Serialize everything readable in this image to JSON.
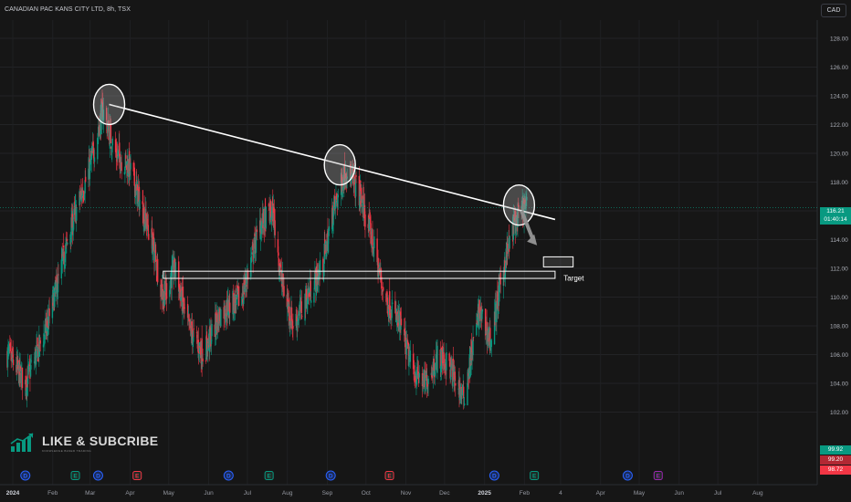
{
  "header": {
    "symbol_title": "CANADIAN PAC KANS CITY LTD, 8h, TSX",
    "currency_button": "CAD"
  },
  "price_scale": {
    "current_price": "116.21",
    "countdown": "01:40:14",
    "current_color": "#089981",
    "tags": [
      {
        "label": "99.92",
        "color": "#089981"
      },
      {
        "label": "99.20",
        "color": "#b22833"
      },
      {
        "label": "98.72",
        "color": "#f23645"
      }
    ]
  },
  "watermark": {
    "title": "LIKE & SUBCRIBE",
    "subtitle": "KNOWLEDGE BASED TRADING"
  },
  "annotations": {
    "target_label": "Target"
  },
  "colors": {
    "up": "#089981",
    "down": "#f23645",
    "background": "#161616",
    "trendline": "#ffffff"
  },
  "chart_data": {
    "type": "candlestick",
    "title": "CANADIAN PAC KANS CITY LTD, 8h, TSX",
    "xlabel": "",
    "ylabel": "",
    "y_axis_side": "right",
    "ylim": [
      97,
      129
    ],
    "y_ticks": [
      "128.00",
      "126.00",
      "124.00",
      "122.00",
      "120.00",
      "118.00",
      "116.00",
      "114.00",
      "112.00",
      "110.00",
      "108.00",
      "106.00",
      "104.00",
      "102.00"
    ],
    "x_ticks": [
      "2024",
      "Feb",
      "Mar",
      "Apr",
      "May",
      "Jun",
      "Jul",
      "Aug",
      "Sep",
      "Oct",
      "Nov",
      "Dec",
      "2025",
      "Feb",
      "4",
      "Apr",
      "May",
      "Jun",
      "Jul",
      "Aug"
    ],
    "grid": true,
    "series": [
      {
        "type": "close_path",
        "x": [
          "2024-01-02",
          "2024-01-15",
          "2024-02-01",
          "2024-02-20",
          "2024-03-05",
          "2024-03-15",
          "2024-03-25",
          "2024-04-05",
          "2024-04-22",
          "2024-05-01",
          "2024-05-10",
          "2024-05-20",
          "2024-06-01",
          "2024-06-15",
          "2024-07-01",
          "2024-07-15",
          "2024-07-25",
          "2024-08-01",
          "2024-08-10",
          "2024-08-20",
          "2024-09-01",
          "2024-09-10",
          "2024-09-20",
          "2024-10-01",
          "2024-10-10",
          "2024-10-20",
          "2024-11-01",
          "2024-11-10",
          "2024-11-20",
          "2024-12-01",
          "2024-12-10",
          "2024-12-20",
          "2025-01-01",
          "2025-01-10",
          "2025-01-20",
          "2025-01-28",
          "2025-02-05"
        ],
        "values": [
          106.0,
          104.0,
          108.0,
          115.0,
          119.0,
          123.0,
          120.0,
          119.0,
          114.0,
          110.0,
          112.0,
          108.0,
          106.0,
          109.0,
          110.0,
          115.0,
          116.0,
          111.0,
          108.0,
          110.0,
          112.0,
          116.0,
          119.0,
          117.0,
          114.0,
          110.0,
          108.0,
          105.0,
          104.0,
          106.0,
          105.0,
          103.0,
          109.0,
          107.0,
          112.0,
          115.0,
          116.2
        ]
      }
    ],
    "price_lines": [
      {
        "value": 116.21,
        "color": "#089981",
        "style": "dotted"
      }
    ],
    "drawings": [
      {
        "type": "trendline",
        "from": {
          "x": "2024-03-20",
          "y": 123.4
        },
        "to": {
          "x": "2025-03-01",
          "y": 115.4
        }
      },
      {
        "type": "circle",
        "at": {
          "x": "2024-03-20",
          "y": 123.4
        }
      },
      {
        "type": "circle",
        "at": {
          "x": "2024-09-15",
          "y": 119.2
        }
      },
      {
        "type": "circle",
        "at": {
          "x": "2025-02-01",
          "y": 116.4
        }
      },
      {
        "type": "arrow",
        "from": {
          "x": "2025-02-03",
          "y": 116.0
        },
        "to": {
          "x": "2025-02-15",
          "y": 113.6
        }
      },
      {
        "type": "rectangle",
        "x": [
          "2024-05-01",
          "2025-03-01"
        ],
        "y": [
          111.3,
          111.8
        ]
      },
      {
        "type": "rectangle",
        "x": [
          "2025-02-20",
          "2025-03-15"
        ],
        "y": [
          112.1,
          112.8
        ],
        "label": "Target"
      }
    ],
    "event_markers": [
      {
        "x": "2024-01",
        "type": "D"
      },
      {
        "x": "2024-02",
        "type": "E"
      },
      {
        "x": "2024-03",
        "type": "D"
      },
      {
        "x": "2024-04",
        "type": "E"
      },
      {
        "x": "2024-06",
        "type": "D"
      },
      {
        "x": "2024-07",
        "type": "E"
      },
      {
        "x": "2024-09",
        "type": "D"
      },
      {
        "x": "2024-10",
        "type": "E"
      },
      {
        "x": "2025-01",
        "type": "D"
      },
      {
        "x": "2025-02",
        "type": "E"
      },
      {
        "x": "2025-04",
        "type": "D"
      },
      {
        "x": "2025-05",
        "type": "E"
      }
    ]
  }
}
